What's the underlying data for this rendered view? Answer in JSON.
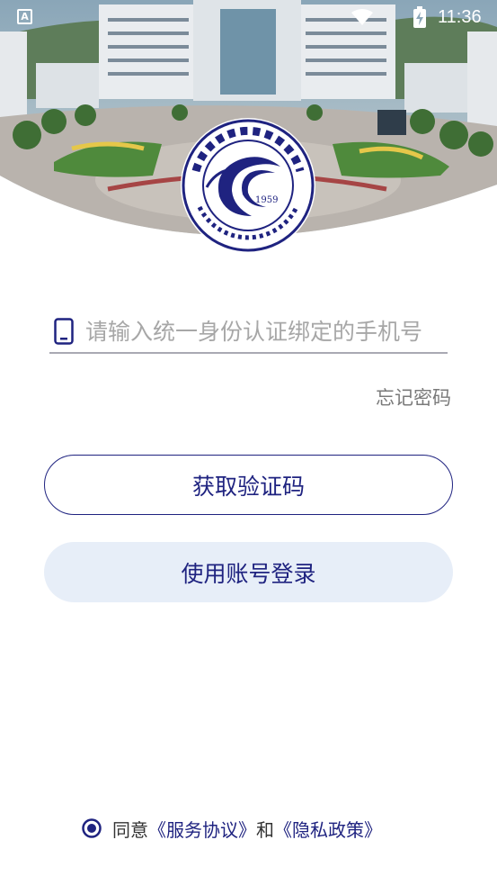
{
  "status_bar": {
    "time": "11:36",
    "a_icon": "A",
    "icons": [
      "a-badge-icon",
      "wifi-icon",
      "battery-charging-icon"
    ]
  },
  "logo": {
    "year": "1959",
    "icon": "university-seal-icon"
  },
  "login": {
    "phone_placeholder": "请输入统一身份认证绑定的手机号",
    "phone_value": "",
    "phone_icon": "phone-icon",
    "forgot_password": "忘记密码",
    "get_code_button": "获取验证码",
    "account_login_button": "使用账号登录"
  },
  "agreement": {
    "prefix": "同意",
    "service_link": "《服务协议》",
    "conjunction": "和",
    "privacy_link": "《隐私政策》",
    "checked": true
  },
  "colors": {
    "accent": "#1f2380",
    "secondary_button_bg": "#e7eef8",
    "muted_text": "#7a7a7a"
  }
}
